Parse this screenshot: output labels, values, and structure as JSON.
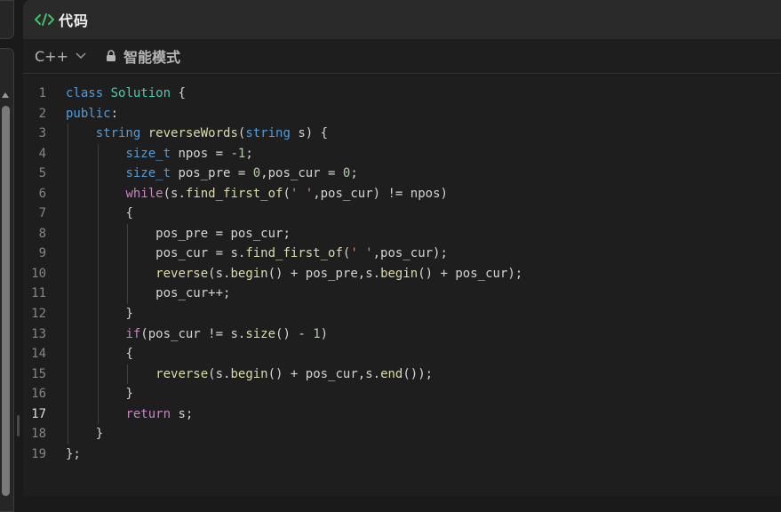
{
  "panel": {
    "title": "代码",
    "icon": "code-icon"
  },
  "toolbar": {
    "language": "C++",
    "mode_label": "智能模式",
    "lock_icon": "lock-icon"
  },
  "editor": {
    "current_line": 17,
    "lines": [
      {
        "n": "1",
        "indent": 0,
        "tokens": [
          [
            "kw",
            "class"
          ],
          [
            "",
            "​ "
          ],
          [
            "ty",
            "Solution"
          ],
          [
            "",
            " {"
          ]
        ]
      },
      {
        "n": "2",
        "indent": 0,
        "tokens": [
          [
            "kw",
            "public"
          ],
          [
            "",
            ":"
          ]
        ]
      },
      {
        "n": "3",
        "indent": 1,
        "tokens": [
          [
            "kw",
            "string"
          ],
          [
            "",
            " "
          ],
          [
            "fn",
            "reverseWords"
          ],
          [
            "",
            "("
          ],
          [
            "kw",
            "string"
          ],
          [
            "",
            " s) {"
          ]
        ]
      },
      {
        "n": "4",
        "indent": 2,
        "tokens": [
          [
            "kw",
            "size_t"
          ],
          [
            "",
            " npos = "
          ],
          [
            "nm",
            "-1"
          ],
          [
            "",
            ";"
          ]
        ]
      },
      {
        "n": "5",
        "indent": 2,
        "tokens": [
          [
            "kw",
            "size_t"
          ],
          [
            "",
            " pos_pre = "
          ],
          [
            "nm",
            "0"
          ],
          [
            "",
            ",pos_cur = "
          ],
          [
            "nm",
            "0"
          ],
          [
            "",
            ";"
          ]
        ]
      },
      {
        "n": "6",
        "indent": 2,
        "tokens": [
          [
            "ct",
            "while"
          ],
          [
            "",
            "(s."
          ],
          [
            "fn",
            "find_first_of"
          ],
          [
            "",
            "("
          ],
          [
            "st",
            "' '"
          ],
          [
            "",
            ",pos_cur) != npos)"
          ]
        ]
      },
      {
        "n": "7",
        "indent": 2,
        "tokens": [
          [
            "",
            "{"
          ]
        ]
      },
      {
        "n": "8",
        "indent": 3,
        "tokens": [
          [
            "",
            "pos_pre = pos_cur;"
          ]
        ]
      },
      {
        "n": "9",
        "indent": 3,
        "tokens": [
          [
            "",
            "pos_cur = s."
          ],
          [
            "fn",
            "find_first_of"
          ],
          [
            "",
            "("
          ],
          [
            "st",
            "' '"
          ],
          [
            "",
            ",pos_cur);"
          ]
        ]
      },
      {
        "n": "10",
        "indent": 3,
        "tokens": [
          [
            "fn",
            "reverse"
          ],
          [
            "",
            "(s."
          ],
          [
            "fn",
            "begin"
          ],
          [
            "",
            "() + pos_pre,s."
          ],
          [
            "fn",
            "begin"
          ],
          [
            "",
            "() + pos_cur);"
          ]
        ]
      },
      {
        "n": "11",
        "indent": 3,
        "tokens": [
          [
            "",
            "pos_cur++;"
          ]
        ]
      },
      {
        "n": "12",
        "indent": 2,
        "tokens": [
          [
            "",
            "}"
          ]
        ]
      },
      {
        "n": "13",
        "indent": 2,
        "tokens": [
          [
            "ct",
            "if"
          ],
          [
            "",
            "(pos_cur != s."
          ],
          [
            "fn",
            "size"
          ],
          [
            "",
            "() - "
          ],
          [
            "nm",
            "1"
          ],
          [
            "",
            ")"
          ]
        ]
      },
      {
        "n": "14",
        "indent": 2,
        "tokens": [
          [
            "",
            "{"
          ]
        ]
      },
      {
        "n": "15",
        "indent": 3,
        "tokens": [
          [
            "fn",
            "reverse"
          ],
          [
            "",
            "(s."
          ],
          [
            "fn",
            "begin"
          ],
          [
            "",
            "() + pos_cur,s."
          ],
          [
            "fn",
            "end"
          ],
          [
            "",
            "());"
          ]
        ]
      },
      {
        "n": "16",
        "indent": 2,
        "tokens": [
          [
            "",
            "}"
          ]
        ]
      },
      {
        "n": "17",
        "indent": 2,
        "tokens": [
          [
            "ct",
            "return"
          ],
          [
            "",
            " s;"
          ]
        ]
      },
      {
        "n": "18",
        "indent": 1,
        "tokens": [
          [
            "",
            "}"
          ]
        ]
      },
      {
        "n": "19",
        "indent": 0,
        "tokens": [
          [
            "",
            "};"
          ]
        ]
      }
    ]
  },
  "colors": {
    "background": "#1e1e1e",
    "keyword": "#569cd6",
    "function": "#dcdcaa",
    "number": "#b5cea8",
    "string": "#ce9178",
    "control": "#c586c0",
    "icon_accent": "#3fbf6a"
  }
}
